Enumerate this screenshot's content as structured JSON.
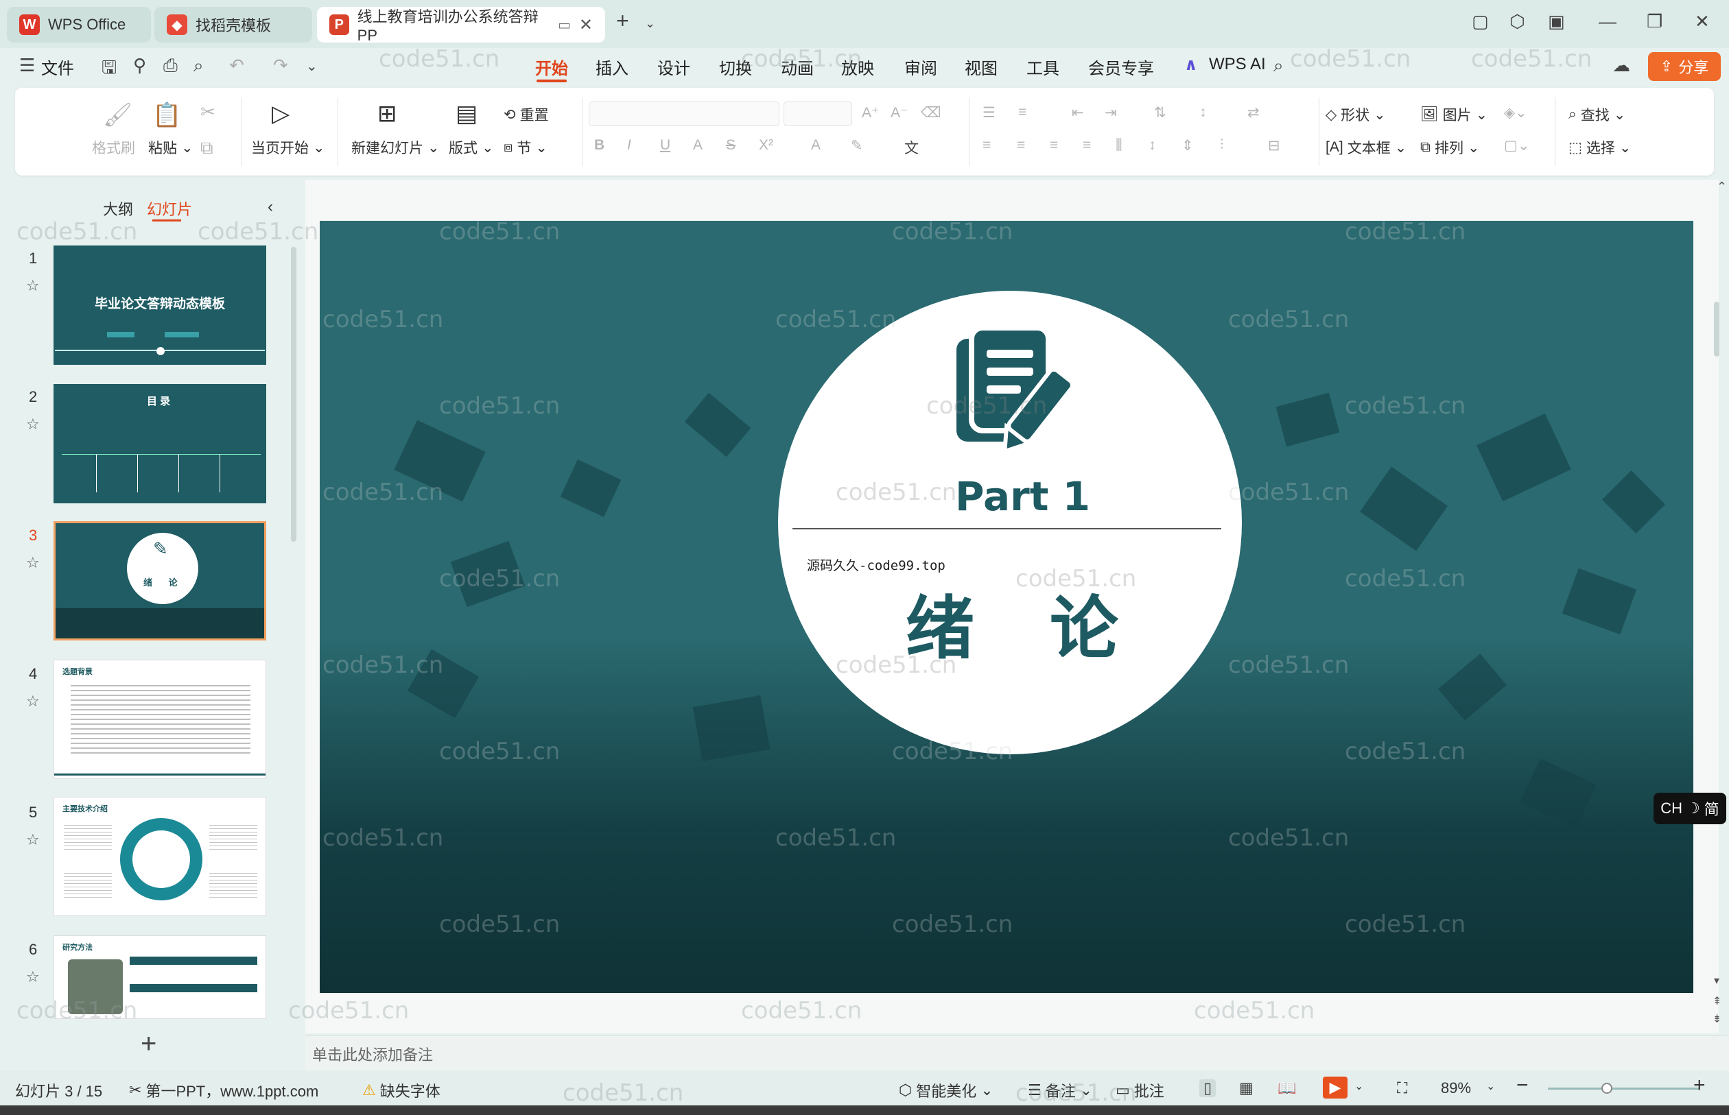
{
  "titlebar": {
    "tabs": [
      {
        "label": "WPS Office",
        "icon": "wps-logo-icon"
      },
      {
        "label": "找稻壳模板",
        "icon": "docer-logo-icon"
      },
      {
        "label": "线上教育培训办公系统答辩PP",
        "icon": "ppt-file-icon"
      }
    ],
    "new_tab": "+"
  },
  "menu": {
    "file": "文件",
    "items": [
      "开始",
      "插入",
      "设计",
      "切换",
      "动画",
      "放映",
      "审阅",
      "视图",
      "工具",
      "会员专享"
    ],
    "active": "开始",
    "wps_ai": "WPS AI",
    "share": "分享"
  },
  "ribbon": {
    "format_painter": "格式刷",
    "paste": "粘贴",
    "play_from_current": "当页开始",
    "new_slide": "新建幻灯片",
    "layout": "版式",
    "reset": "重置",
    "section": "节",
    "shape": "形状",
    "picture": "图片",
    "textbox": "文本框",
    "arrange": "排列",
    "find": "查找",
    "select": "选择"
  },
  "left_panel": {
    "tab_outline": "大纲",
    "tab_slides": "幻灯片",
    "slides": [
      {
        "num": "1",
        "title": "毕业论文答辩动态模板"
      },
      {
        "num": "2",
        "title": "目 录"
      },
      {
        "num": "3",
        "title": "绪 论"
      },
      {
        "num": "4",
        "title": "选题背景"
      },
      {
        "num": "5",
        "title": "主要技术介绍"
      },
      {
        "num": "6",
        "title": "研究方法"
      }
    ],
    "add": "+"
  },
  "slide": {
    "part": "Part 1",
    "watermark_text": "源码久久-code99.top",
    "section_title": "绪论"
  },
  "notes": {
    "placeholder": "单击此处添加备注"
  },
  "statusbar": {
    "slide_counter": "幻灯片 3 / 15",
    "theme": "第一PPT，www.1ppt.com",
    "missing_font": "缺失字体",
    "beautify": "智能美化",
    "notes": "备注",
    "comments": "批注",
    "zoom": "89%"
  },
  "ime": {
    "label": "CH",
    "mode": "简"
  },
  "watermark": "code51.cn",
  "colors": {
    "accent": "#e0451b",
    "slide_teal": "#1e5a61",
    "share_orange": "#f06a2a"
  }
}
